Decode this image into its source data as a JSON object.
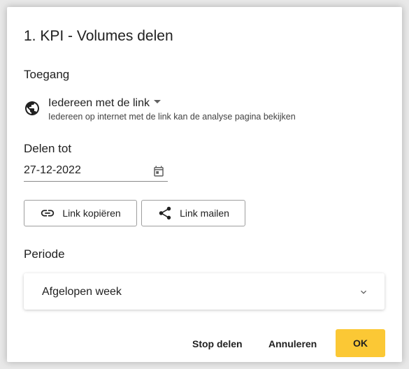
{
  "dialog": {
    "title": "1. KPI - Volumes delen"
  },
  "access": {
    "label": "Toegang",
    "selected": "Iedereen met de link",
    "description": "Iedereen op internet met de link kan de analyse pagina bekijken",
    "icon": "globe-icon"
  },
  "share_until": {
    "label": "Delen tot",
    "value": "27-12-2022",
    "icon": "calendar-icon"
  },
  "share_buttons": {
    "copy_label": "Link kopiëren",
    "copy_icon": "link-icon",
    "mail_label": "Link mailen",
    "mail_icon": "share-icon"
  },
  "period": {
    "label": "Periode",
    "selected": "Afgelopen week",
    "icon": "chevron-down-icon"
  },
  "footer": {
    "stop_label": "Stop delen",
    "cancel_label": "Annuleren",
    "ok_label": "OK",
    "ok_color": "#fbc835"
  }
}
